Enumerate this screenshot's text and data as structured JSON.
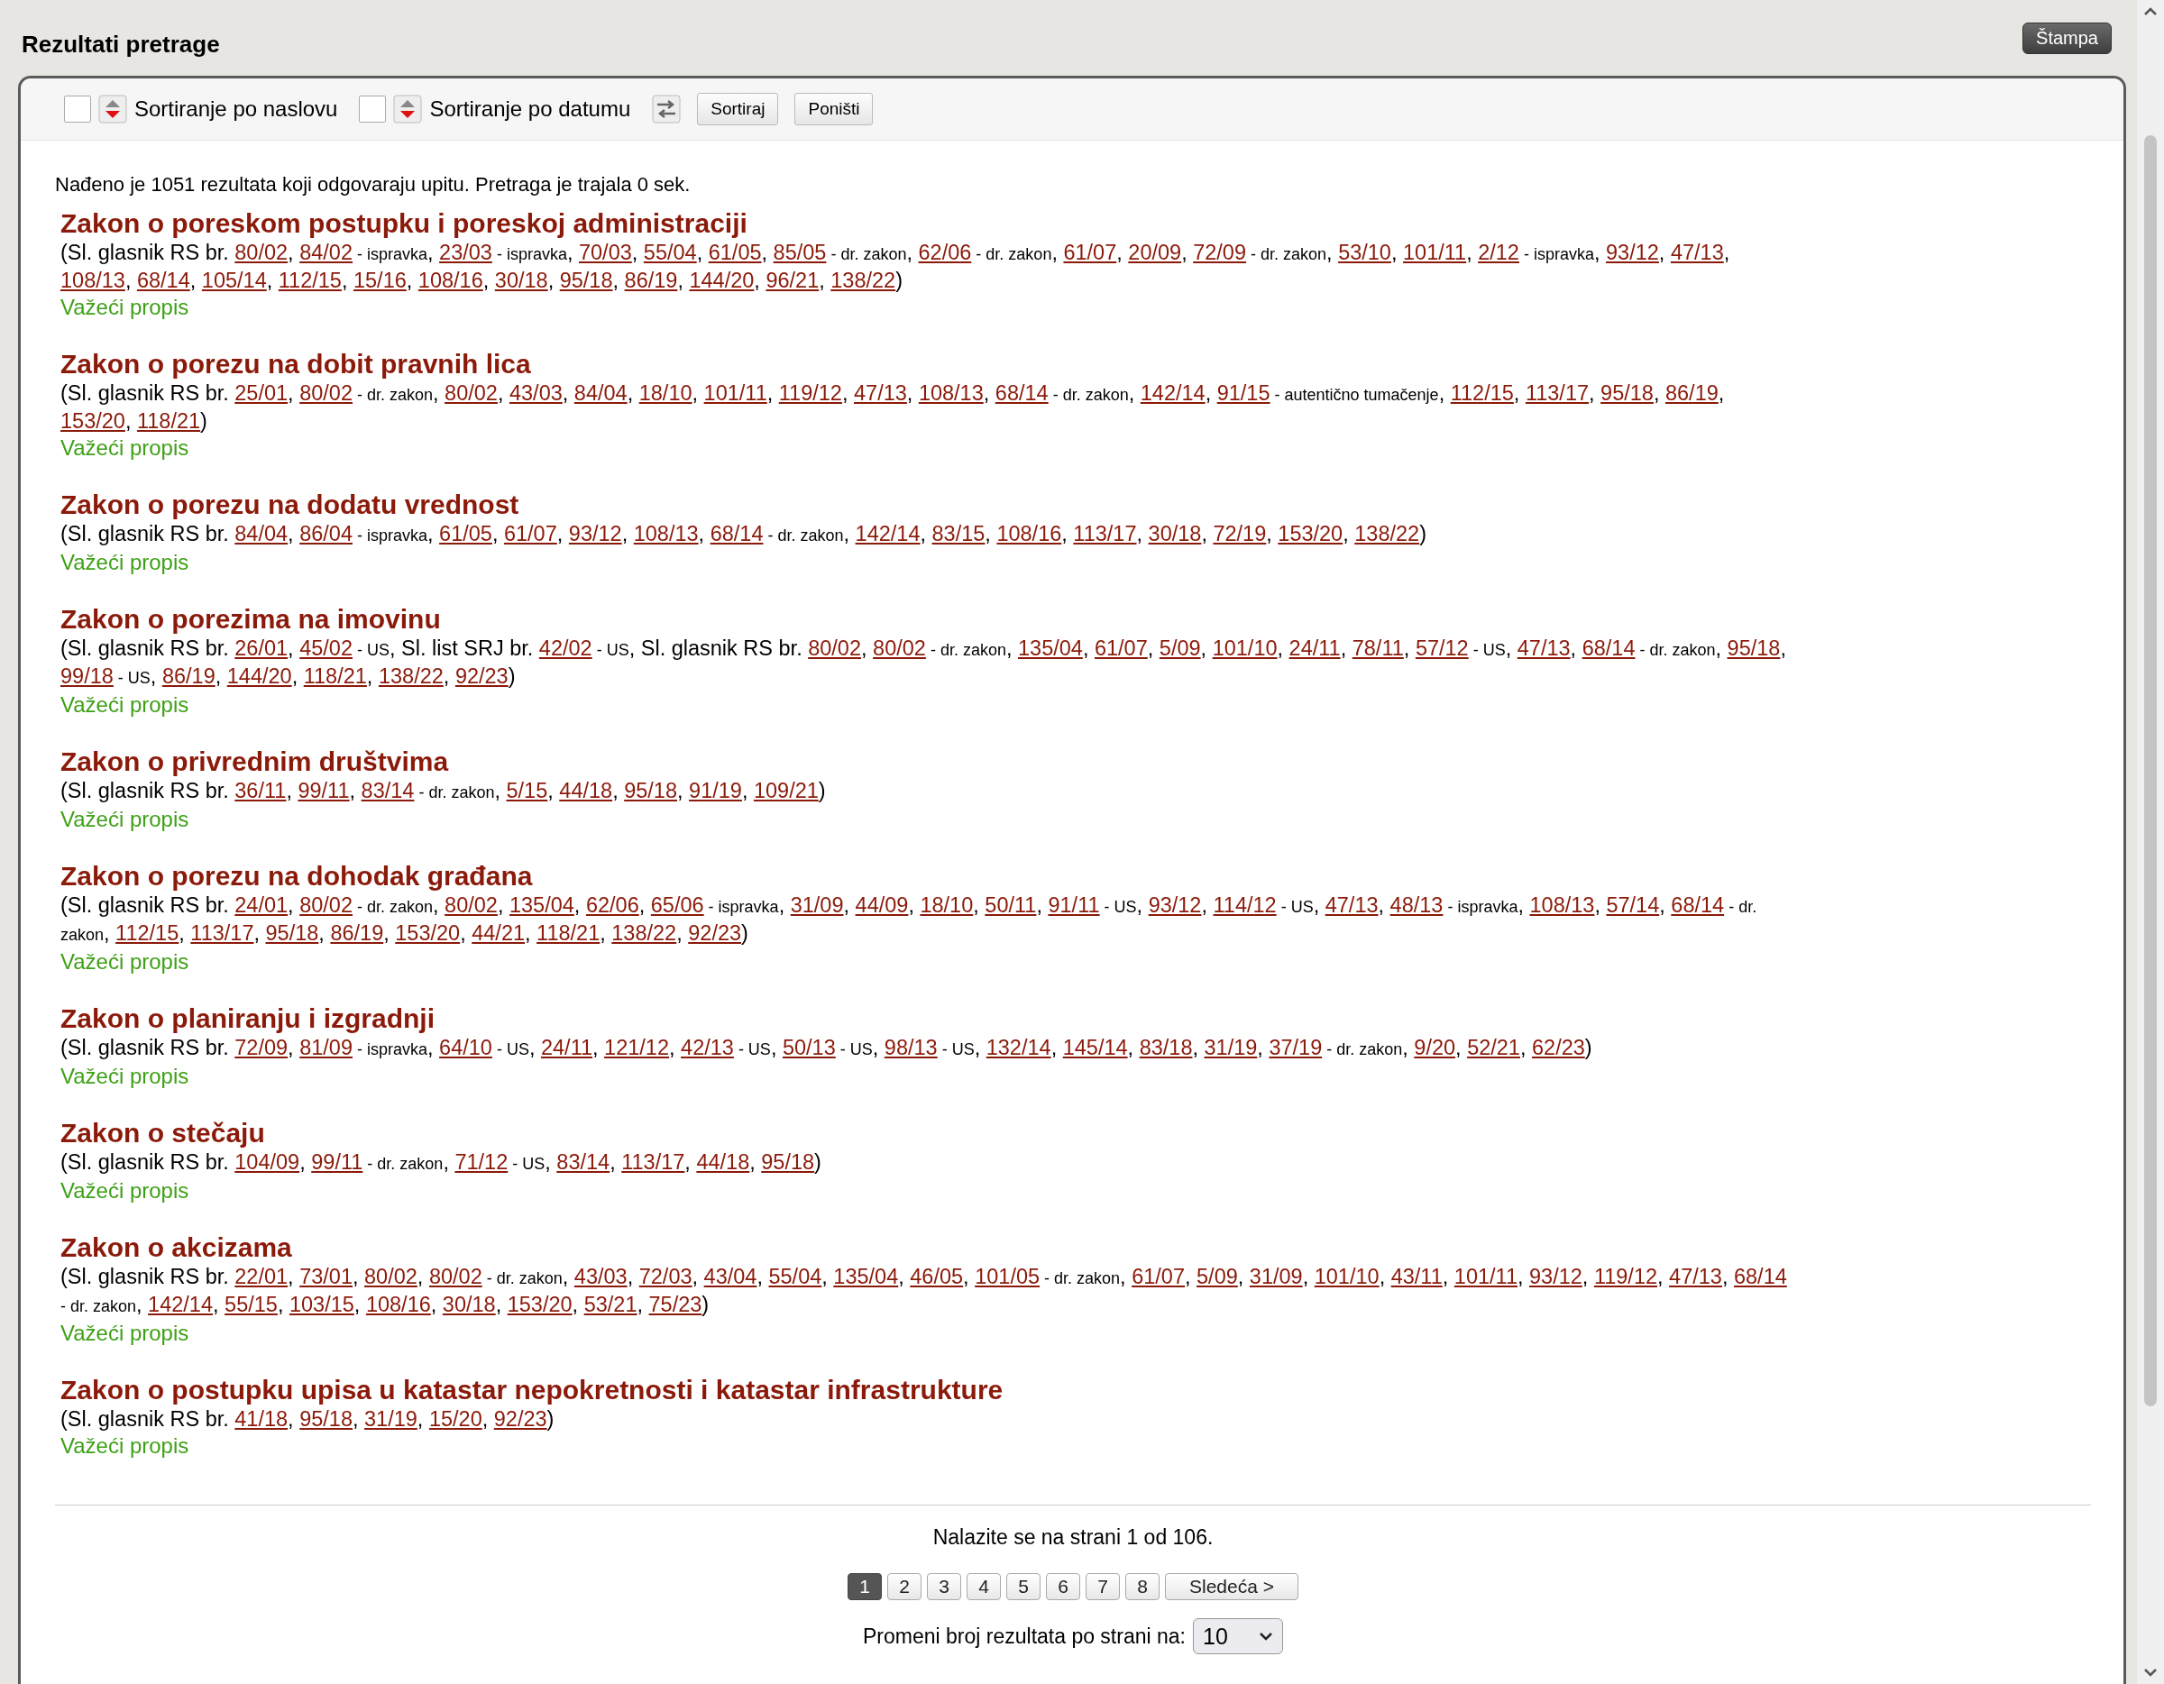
{
  "page_title": "Rezultati pretrage",
  "print_button": "Štampa",
  "toolbar": {
    "sort_options": [
      {
        "label": "Sortiranje po naslovu",
        "checked": false
      },
      {
        "label": "Sortiranje po datumu",
        "checked": false
      }
    ],
    "buttons": [
      "Sortiraj",
      "Poništi"
    ]
  },
  "summary": "Nađeno je 1051 rezultata koji odgovaraju upitu. Pretraga je trajala 0 sek.",
  "results": [
    {
      "title": "Zakon o poreskom postupku i poreskoj administraciji",
      "prefix": "(Sl. glasnik RS br. ",
      "refs": [
        {
          "ref": "80/02",
          "after": ", "
        },
        {
          "ref": "84/02",
          "note": " - ispravka",
          "after": ", "
        },
        {
          "ref": "23/03",
          "note": " - ispravka",
          "after": ", "
        },
        {
          "ref": "70/03",
          "after": ", "
        },
        {
          "ref": "55/04",
          "after": ", "
        },
        {
          "ref": "61/05",
          "after": ", "
        },
        {
          "ref": "85/05",
          "note": " - dr. zakon",
          "after": ", "
        },
        {
          "ref": "62/06",
          "note": " - dr. zakon",
          "after": ", "
        },
        {
          "ref": "61/07",
          "after": ", "
        },
        {
          "ref": "20/09",
          "after": ", "
        },
        {
          "ref": "72/09",
          "note": " - dr. zakon",
          "after": ", "
        },
        {
          "ref": "53/10",
          "after": ", "
        },
        {
          "ref": "101/11",
          "after": ", "
        },
        {
          "ref": "2/12",
          "note": " - ispravka",
          "after": ", "
        },
        {
          "ref": "93/12",
          "after": ", "
        },
        {
          "ref": "47/13",
          "after": ", "
        },
        {
          "ref": "108/13",
          "after": ", "
        },
        {
          "ref": "68/14",
          "after": ", "
        },
        {
          "ref": "105/14",
          "after": ", "
        },
        {
          "ref": "112/15",
          "after": ", "
        },
        {
          "ref": "15/16",
          "after": ", "
        },
        {
          "ref": "108/16",
          "after": ", "
        },
        {
          "ref": "30/18",
          "after": ", "
        },
        {
          "ref": "95/18",
          "after": ", "
        },
        {
          "ref": "86/19",
          "after": ", "
        },
        {
          "ref": "144/20",
          "after": ", "
        },
        {
          "ref": "96/21",
          "after": ", "
        },
        {
          "ref": "138/22",
          "after": ")"
        }
      ],
      "status": "Važeći propis"
    },
    {
      "title": "Zakon o porezu na dobit pravnih lica",
      "prefix": "(Sl. glasnik RS br. ",
      "refs": [
        {
          "ref": "25/01",
          "after": ", "
        },
        {
          "ref": "80/02",
          "note": " - dr. zakon",
          "after": ", "
        },
        {
          "ref": "80/02",
          "after": ", "
        },
        {
          "ref": "43/03",
          "after": ", "
        },
        {
          "ref": "84/04",
          "after": ", "
        },
        {
          "ref": "18/10",
          "after": ", "
        },
        {
          "ref": "101/11",
          "after": ", "
        },
        {
          "ref": "119/12",
          "after": ", "
        },
        {
          "ref": "47/13",
          "after": ", "
        },
        {
          "ref": "108/13",
          "after": ", "
        },
        {
          "ref": "68/14",
          "note": " - dr. zakon",
          "after": ", "
        },
        {
          "ref": "142/14",
          "after": ", "
        },
        {
          "ref": "91/15",
          "note": " - autentično tumačenje",
          "after": ", "
        },
        {
          "ref": "112/15",
          "after": ", "
        },
        {
          "ref": "113/17",
          "after": ", "
        },
        {
          "ref": "95/18",
          "after": ", "
        },
        {
          "ref": "86/19",
          "after": ", "
        },
        {
          "ref": "153/20",
          "after": ", "
        },
        {
          "ref": "118/21",
          "after": ")"
        }
      ],
      "status": "Važeći propis"
    },
    {
      "title": "Zakon o porezu na dodatu vrednost",
      "prefix": "(Sl. glasnik RS br. ",
      "refs": [
        {
          "ref": "84/04",
          "after": ", "
        },
        {
          "ref": "86/04",
          "note": " - ispravka",
          "after": ", "
        },
        {
          "ref": "61/05",
          "after": ", "
        },
        {
          "ref": "61/07",
          "after": ", "
        },
        {
          "ref": "93/12",
          "after": ", "
        },
        {
          "ref": "108/13",
          "after": ", "
        },
        {
          "ref": "68/14",
          "note": " - dr. zakon",
          "after": ", "
        },
        {
          "ref": "142/14",
          "after": ", "
        },
        {
          "ref": "83/15",
          "after": ", "
        },
        {
          "ref": "108/16",
          "after": ", "
        },
        {
          "ref": "113/17",
          "after": ", "
        },
        {
          "ref": "30/18",
          "after": ", "
        },
        {
          "ref": "72/19",
          "after": ", "
        },
        {
          "ref": "153/20",
          "after": ", "
        },
        {
          "ref": "138/22",
          "after": ")"
        }
      ],
      "status": "Važeći propis"
    },
    {
      "title": "Zakon o porezima na imovinu",
      "prefix": "(Sl. glasnik RS br. ",
      "refs": [
        {
          "ref": "26/01",
          "after": ", "
        },
        {
          "ref": "45/02",
          "note": " - US",
          "after": ", Sl. list SRJ br. "
        },
        {
          "ref": "42/02",
          "note": " - US",
          "after": ", Sl. glasnik RS br. "
        },
        {
          "ref": "80/02",
          "after": ", "
        },
        {
          "ref": "80/02",
          "note": " - dr. zakon",
          "after": ", "
        },
        {
          "ref": "135/04",
          "after": ", "
        },
        {
          "ref": "61/07",
          "after": ", "
        },
        {
          "ref": "5/09",
          "after": ", "
        },
        {
          "ref": "101/10",
          "after": ", "
        },
        {
          "ref": "24/11",
          "after": ", "
        },
        {
          "ref": "78/11",
          "after": ", "
        },
        {
          "ref": "57/12",
          "note": " - US",
          "after": ", "
        },
        {
          "ref": "47/13",
          "after": ", "
        },
        {
          "ref": "68/14",
          "note": " - dr. zakon",
          "after": ", "
        },
        {
          "ref": "95/18",
          "after": ", "
        },
        {
          "ref": "99/18",
          "note": " - US",
          "after": ", "
        },
        {
          "ref": "86/19",
          "after": ", "
        },
        {
          "ref": "144/20",
          "after": ", "
        },
        {
          "ref": "118/21",
          "after": ", "
        },
        {
          "ref": "138/22",
          "after": ", "
        },
        {
          "ref": "92/23",
          "after": ")"
        }
      ],
      "status": "Važeći propis"
    },
    {
      "title": "Zakon o privrednim društvima",
      "prefix": "(Sl. glasnik RS br. ",
      "refs": [
        {
          "ref": "36/11",
          "after": ", "
        },
        {
          "ref": "99/11",
          "after": ", "
        },
        {
          "ref": "83/14",
          "note": " - dr. zakon",
          "after": ", "
        },
        {
          "ref": "5/15",
          "after": ", "
        },
        {
          "ref": "44/18",
          "after": ", "
        },
        {
          "ref": "95/18",
          "after": ", "
        },
        {
          "ref": "91/19",
          "after": ", "
        },
        {
          "ref": "109/21",
          "after": ")"
        }
      ],
      "status": "Važeći propis"
    },
    {
      "title": "Zakon o porezu na dohodak građana",
      "prefix": "(Sl. glasnik RS br. ",
      "refs": [
        {
          "ref": "24/01",
          "after": ", "
        },
        {
          "ref": "80/02",
          "note": " - dr. zakon",
          "after": ", "
        },
        {
          "ref": "80/02",
          "after": ", "
        },
        {
          "ref": "135/04",
          "after": ", "
        },
        {
          "ref": "62/06",
          "after": ", "
        },
        {
          "ref": "65/06",
          "note": " - ispravka",
          "after": ", "
        },
        {
          "ref": "31/09",
          "after": ", "
        },
        {
          "ref": "44/09",
          "after": ", "
        },
        {
          "ref": "18/10",
          "after": ", "
        },
        {
          "ref": "50/11",
          "after": ", "
        },
        {
          "ref": "91/11",
          "note": " - US",
          "after": ", "
        },
        {
          "ref": "93/12",
          "after": ", "
        },
        {
          "ref": "114/12",
          "note": " - US",
          "after": ", "
        },
        {
          "ref": "47/13",
          "after": ", "
        },
        {
          "ref": "48/13",
          "note": " - ispravka",
          "after": ", "
        },
        {
          "ref": "108/13",
          "after": ", "
        },
        {
          "ref": "57/14",
          "after": ", "
        },
        {
          "ref": "68/14",
          "note": " - dr. zakon",
          "after": ", "
        },
        {
          "ref": "112/15",
          "after": ", "
        },
        {
          "ref": "113/17",
          "after": ", "
        },
        {
          "ref": "95/18",
          "after": ", "
        },
        {
          "ref": "86/19",
          "after": ", "
        },
        {
          "ref": "153/20",
          "after": ", "
        },
        {
          "ref": "44/21",
          "after": ", "
        },
        {
          "ref": "118/21",
          "after": ", "
        },
        {
          "ref": "138/22",
          "after": ", "
        },
        {
          "ref": "92/23",
          "after": ")"
        }
      ],
      "status": "Važeći propis"
    },
    {
      "title": "Zakon o planiranju i izgradnji",
      "prefix": "(Sl. glasnik RS br. ",
      "refs": [
        {
          "ref": "72/09",
          "after": ", "
        },
        {
          "ref": "81/09",
          "note": " - ispravka",
          "after": ", "
        },
        {
          "ref": "64/10",
          "note": " - US",
          "after": ", "
        },
        {
          "ref": "24/11",
          "after": ", "
        },
        {
          "ref": "121/12",
          "after": ", "
        },
        {
          "ref": "42/13",
          "note": " - US",
          "after": ", "
        },
        {
          "ref": "50/13",
          "note": " - US",
          "after": ", "
        },
        {
          "ref": "98/13",
          "note": " - US",
          "after": ", "
        },
        {
          "ref": "132/14",
          "after": ", "
        },
        {
          "ref": "145/14",
          "after": ", "
        },
        {
          "ref": "83/18",
          "after": ", "
        },
        {
          "ref": "31/19",
          "after": ", "
        },
        {
          "ref": "37/19",
          "note": " - dr. zakon",
          "after": ", "
        },
        {
          "ref": "9/20",
          "after": ", "
        },
        {
          "ref": "52/21",
          "after": ", "
        },
        {
          "ref": "62/23",
          "after": ")"
        }
      ],
      "status": "Važeći propis"
    },
    {
      "title": "Zakon o stečaju",
      "prefix": "(Sl. glasnik RS br. ",
      "refs": [
        {
          "ref": "104/09",
          "after": ", "
        },
        {
          "ref": "99/11",
          "note": " - dr. zakon",
          "after": ", "
        },
        {
          "ref": "71/12",
          "note": " - US",
          "after": ", "
        },
        {
          "ref": "83/14",
          "after": ", "
        },
        {
          "ref": "113/17",
          "after": ", "
        },
        {
          "ref": "44/18",
          "after": ", "
        },
        {
          "ref": "95/18",
          "after": ")"
        }
      ],
      "status": "Važeći propis"
    },
    {
      "title": "Zakon o akcizama",
      "prefix": "(Sl. glasnik RS br. ",
      "refs": [
        {
          "ref": "22/01",
          "after": ", "
        },
        {
          "ref": "73/01",
          "after": ", "
        },
        {
          "ref": "80/02",
          "after": ", "
        },
        {
          "ref": "80/02",
          "note": " - dr. zakon",
          "after": ", "
        },
        {
          "ref": "43/03",
          "after": ", "
        },
        {
          "ref": "72/03",
          "after": ", "
        },
        {
          "ref": "43/04",
          "after": ", "
        },
        {
          "ref": "55/04",
          "after": ", "
        },
        {
          "ref": "135/04",
          "after": ", "
        },
        {
          "ref": "46/05",
          "after": ", "
        },
        {
          "ref": "101/05",
          "note": " - dr. zakon",
          "after": ", "
        },
        {
          "ref": "61/07",
          "after": ", "
        },
        {
          "ref": "5/09",
          "after": ", "
        },
        {
          "ref": "31/09",
          "after": ", "
        },
        {
          "ref": "101/10",
          "after": ", "
        },
        {
          "ref": "43/11",
          "after": ", "
        },
        {
          "ref": "101/11",
          "after": ", "
        },
        {
          "ref": "93/12",
          "after": ", "
        },
        {
          "ref": "119/12",
          "after": ", "
        },
        {
          "ref": "47/13",
          "after": ", "
        },
        {
          "ref": "68/14",
          "note": " - dr. zakon",
          "after": ", "
        },
        {
          "ref": "142/14",
          "after": ", "
        },
        {
          "ref": "55/15",
          "after": ", "
        },
        {
          "ref": "103/15",
          "after": ", "
        },
        {
          "ref": "108/16",
          "after": ", "
        },
        {
          "ref": "30/18",
          "after": ", "
        },
        {
          "ref": "153/20",
          "after": ", "
        },
        {
          "ref": "53/21",
          "after": ", "
        },
        {
          "ref": "75/23",
          "after": ")"
        }
      ],
      "status": "Važeći propis"
    },
    {
      "title": "Zakon o postupku upisa u katastar nepokretnosti i katastar infrastrukture",
      "prefix": "(Sl. glasnik RS br. ",
      "refs": [
        {
          "ref": "41/18",
          "after": ", "
        },
        {
          "ref": "95/18",
          "after": ", "
        },
        {
          "ref": "31/19",
          "after": ", "
        },
        {
          "ref": "15/20",
          "after": ", "
        },
        {
          "ref": "92/23",
          "after": ")"
        }
      ],
      "status": "Važeći propis"
    }
  ],
  "pagination": {
    "info": "Nalazite se na strani 1 od 106.",
    "pages": [
      {
        "label": "1",
        "selected": true
      },
      {
        "label": "2",
        "selected": false
      },
      {
        "label": "3",
        "selected": false
      },
      {
        "label": "4",
        "selected": false
      },
      {
        "label": "5",
        "selected": false
      },
      {
        "label": "6",
        "selected": false
      },
      {
        "label": "7",
        "selected": false
      },
      {
        "label": "8",
        "selected": false
      }
    ],
    "next": "Sledeća >",
    "page_size_label": "Promeni broj rezultata po strani na:",
    "page_size": "10"
  }
}
